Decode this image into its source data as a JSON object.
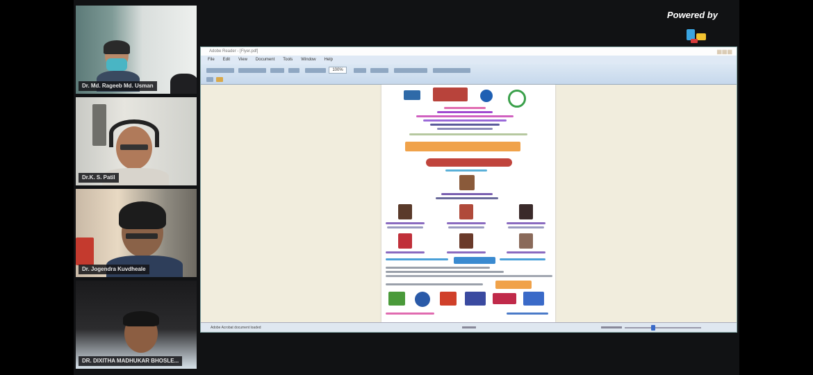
{
  "participants": [
    {
      "name": "Dr. Md. Rageeb Md. Usman"
    },
    {
      "name": "Dr.K. S. Patil"
    },
    {
      "name": "Dr. Jogendra Kuvdheale"
    },
    {
      "name": "DR. DIXITHA MADHUKAR BHOSLE..."
    }
  ],
  "branding": {
    "powered_by": "Powered by",
    "app_logo": "presenter-logo"
  },
  "shared_screen": {
    "window_title": "Adobe Reader - [Flyer.pdf]",
    "menu": [
      "File",
      "Edit",
      "View",
      "Document",
      "Tools",
      "Window",
      "Help"
    ],
    "zoom": "100%",
    "status_left": "Adobe Acrobat document loaded"
  },
  "colors": {
    "accent": "#f0a24a",
    "banner_red": "#c0443c",
    "menu_bg": "#dfe9f5"
  }
}
